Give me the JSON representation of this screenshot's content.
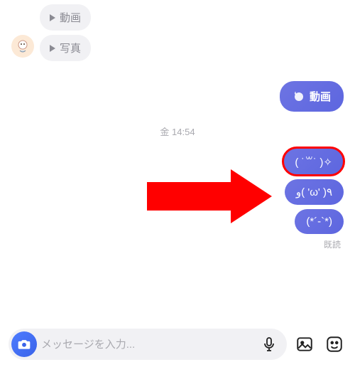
{
  "incoming": [
    {
      "label": "動画"
    },
    {
      "label": "写真"
    }
  ],
  "outgoing_media": {
    "label": "動画"
  },
  "timestamp": "金 14:54",
  "outgoing_text": [
    "( ˙꒳​˙ )✧",
    "و( 'ω' )٩",
    "(*´-`*)"
  ],
  "read_label": "既読",
  "composer": {
    "placeholder": "メッセージを入力..."
  },
  "colors": {
    "highlight": "#ff0000",
    "bubble_out": "#5d66df",
    "bubble_in": "#f1f1f4"
  }
}
